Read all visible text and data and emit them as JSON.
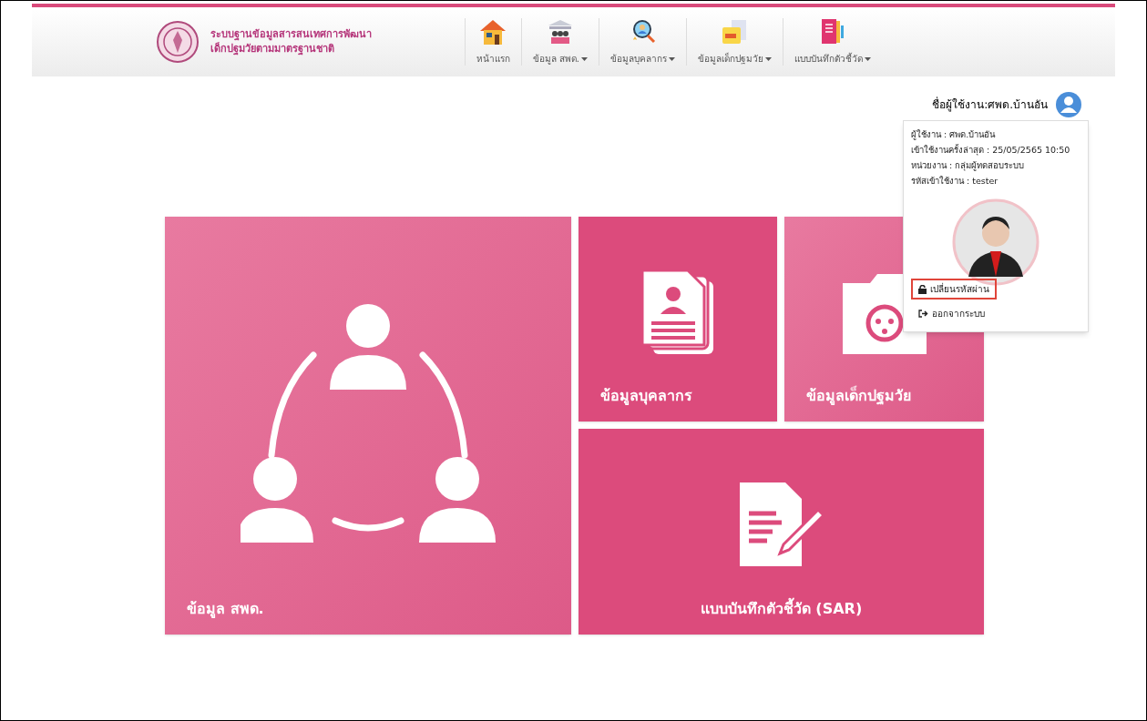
{
  "header": {
    "title_lines": [
      "ระบบฐานข้อมูลสารสนเทศการพัฒนา",
      "เด็กปฐมวัยตามมาตรฐานชาติ"
    ],
    "nav": [
      {
        "kind": "house",
        "label": "หน้าแรก",
        "dropdown": false
      },
      {
        "kind": "building",
        "label": "ข้อมูล สพด.",
        "dropdown": true
      },
      {
        "kind": "search-person",
        "label": "ข้อมูลบุคลากร",
        "dropdown": true
      },
      {
        "kind": "doc",
        "label": "ข้อมูลเด็กปฐมวัย",
        "dropdown": true
      },
      {
        "kind": "notebook",
        "label": "แบบบันทึกตัวชี้วัด",
        "dropdown": true
      }
    ]
  },
  "user": {
    "label": "ชื่อผู้ใช้งาน:ศพด.บ้านอัน",
    "panel": {
      "info": [
        "ผู้ใช้งาน : ศพด.บ้านอัน",
        "เข้าใช้งานครั้งล่าสุด : 25/05/2565 10:50",
        "หน่วยงาน : กลุ่มผู้ทดสอบระบบ",
        "รหัสเข้าใช้งาน : tester"
      ],
      "actions": [
        {
          "kind": "lock",
          "label": "เปลี่ยนรหัสผ่าน",
          "highlighted": true
        },
        {
          "kind": "logout",
          "label": "ออกจากระบบ",
          "highlighted": false
        }
      ]
    }
  },
  "tiles": [
    {
      "kind": "people",
      "label": "ข้อมูล สพด.",
      "photo": true
    },
    {
      "kind": "document",
      "label": "ข้อมูลบุคลากร",
      "photo": false
    },
    {
      "kind": "baby-folder",
      "label": "ข้อมูลเด็กปฐมวัย",
      "photo": true
    },
    {
      "kind": "edit",
      "label": "แบบบันทึกตัวชี้วัด (SAR)",
      "photo": false
    }
  ]
}
